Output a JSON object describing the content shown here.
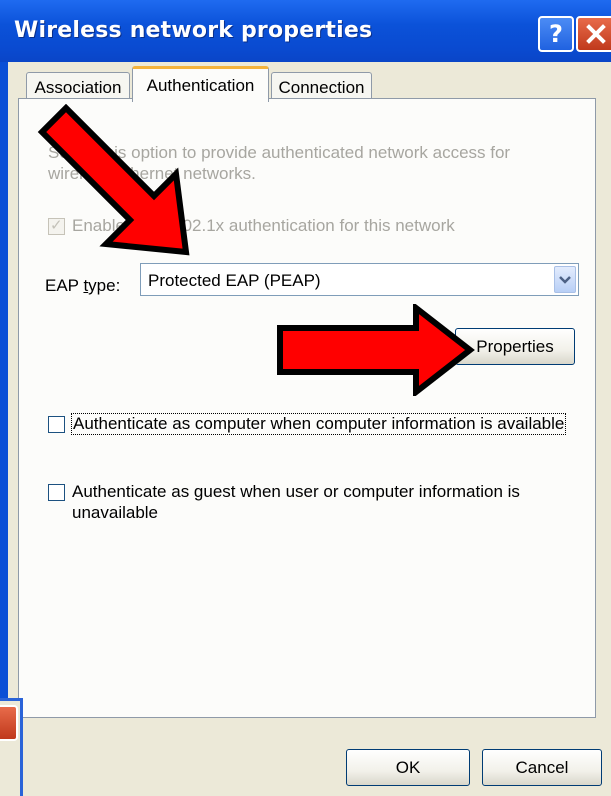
{
  "window": {
    "title": "Wireless network properties",
    "help_icon": "question-mark-icon",
    "close_icon": "close-icon"
  },
  "tabs": [
    {
      "label": "Association",
      "active": false
    },
    {
      "label": "Authentication",
      "active": true
    },
    {
      "label": "Connection",
      "active": false
    }
  ],
  "authentication": {
    "description_line1": "Select this option to provide authenticated network access for",
    "description_line2": "wireless Ethernet networks.",
    "enable_8021x": {
      "label": "Enable IEEE 802.1x authentication for this network",
      "checked": true,
      "disabled": true
    },
    "eap_type_label": "EAP type:",
    "eap_type_value": "Protected EAP (PEAP)",
    "properties_button": "Properties",
    "auth_as_computer": {
      "label": "Authenticate as computer when computer information is available",
      "checked": false
    },
    "auth_as_guest": {
      "label_line1": "Authenticate as guest when user or computer information is",
      "label_line2": "unavailable",
      "checked": false
    }
  },
  "footer": {
    "ok_label": "OK",
    "cancel_label": "Cancel"
  },
  "annotations": {
    "arrow_color": "#ff0000",
    "arrow_outline": "#000000"
  }
}
